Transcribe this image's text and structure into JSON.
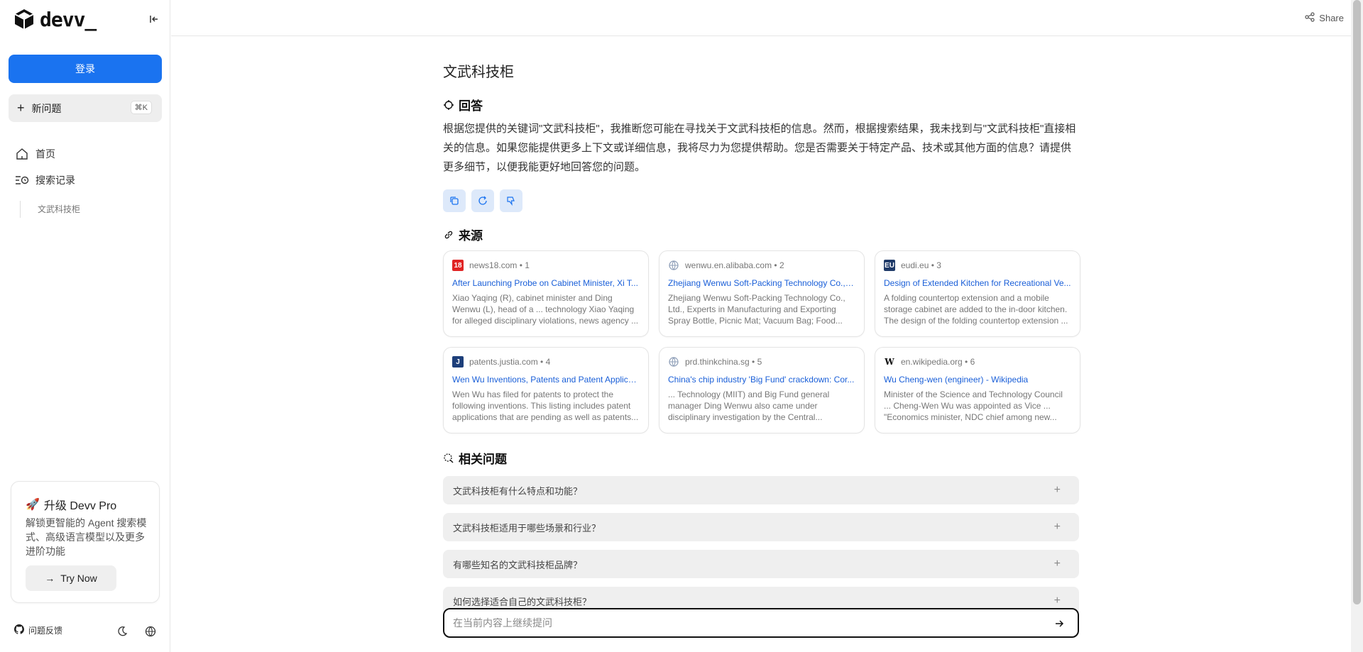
{
  "brand": {
    "name": "devv_"
  },
  "sidebar": {
    "login_label": "登录",
    "new_question_label": "新问题",
    "new_question_shortcut": "⌘K",
    "nav": [
      {
        "label": "首页"
      },
      {
        "label": "搜索记录"
      }
    ],
    "history": [
      "文武科技柜"
    ],
    "pro": {
      "title": "升级 Devv Pro",
      "desc": "解锁更智能的 Agent 搜索模式、高级语言模型以及更多进阶功能",
      "try_label": "Try Now"
    },
    "feedback_label": "问题反馈"
  },
  "topbar": {
    "share_label": "Share"
  },
  "main": {
    "query": "文武科技柜",
    "answer_heading": "回答",
    "answer_text": "根据您提供的关键词\"文武科技柜\"，我推断您可能在寻找关于文武科技柜的信息。然而，根据搜索结果，我未找到与\"文武科技柜\"直接相关的信息。如果您能提供更多上下文或详细信息，我将尽力为您提供帮助。您是否需要关于特定产品、技术或其他方面的信息？请提供更多细节，以便我能更好地回答您的问题。",
    "sources_heading": "来源",
    "sources": [
      {
        "site": "news18.com • 1",
        "title": "After Launching Probe on Cabinet Minister, Xi T...",
        "snippet": "Xiao Yaqing (R), cabinet minister and Ding Wenwu (L), head of a ... technology Xiao Yaqing for alleged disciplinary violations, news agency ...",
        "favicon": "18",
        "favicon_color": "#e02424"
      },
      {
        "site": "wenwu.en.alibaba.com • 2",
        "title": "Zhejiang Wenwu Soft-Packing Technology Co., L...",
        "snippet": "Zhejiang Wenwu Soft-Packing Technology Co., Ltd., Experts in Manufacturing and Exporting Spray Bottle, Picnic Mat; Vacuum Bag; Food...",
        "favicon": "globe",
        "favicon_color": "#8a9bb5"
      },
      {
        "site": "eudi.eu • 3",
        "title": "Design of Extended Kitchen for Recreational Ve...",
        "snippet": "A folding countertop extension and a mobile storage cabinet are added to the in-door kitchen. The design of the folding countertop extension ...",
        "favicon": "EU",
        "favicon_color": "#1f3a68"
      },
      {
        "site": "patents.justia.com • 4",
        "title": "Wen Wu Inventions, Patents and Patent Applica...",
        "snippet": "Wen Wu has filed for patents to protect the following inventions. This listing includes patent applications that are pending as well as patents...",
        "favicon": "J",
        "favicon_color": "#1d3f7a"
      },
      {
        "site": "prd.thinkchina.sg • 5",
        "title": "China's chip industry 'Big Fund' crackdown: Cor...",
        "snippet": "... Technology (MIIT) and Big Fund general manager Ding Wenwu also came under disciplinary investigation by the Central...",
        "favicon": "globe",
        "favicon_color": "#8a9bb5"
      },
      {
        "site": "en.wikipedia.org • 6",
        "title": "Wu Cheng-wen (engineer) - Wikipedia",
        "snippet": "Minister of the Science and Technology Council ... Cheng-Wen Wu was appointed as Vice ... \"Economics minister, NDC chief among new...",
        "favicon": "W",
        "favicon_color": "#ffffff"
      }
    ],
    "related_heading": "相关问题",
    "related": [
      "文武科技柜有什么特点和功能？",
      "文武科技柜适用于哪些场景和行业？",
      "有哪些知名的文武科技柜品牌？",
      "如何选择适合自己的文武科技柜？"
    ],
    "ask_placeholder": "在当前内容上继续提问"
  },
  "colors": {
    "accent": "#1a73f0",
    "link": "#1a5fd8",
    "action_bg": "#dde9fa"
  }
}
